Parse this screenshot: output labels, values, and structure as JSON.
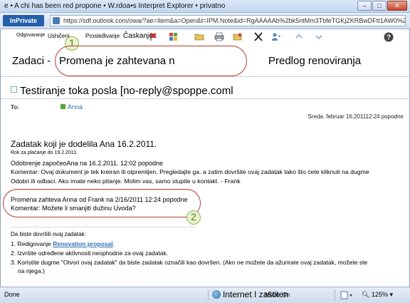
{
  "window": {
    "title": "e • A chi has been red propone • W.rdoa•s Interpret Explorer • privatno",
    "min": "–",
    "max": "□",
    "close": "✕"
  },
  "address": {
    "inprivate": "InPrivate",
    "url": "https://sdf.outlook.com/owa/?ae=Item&a=Open&t=IPM.Note&id=RgAAAAAb%2bk5ntMm3TbfeTGKjZKRBwDFtt1AW0%2fSAQIKF"
  },
  "toolbar": {
    "reply": "Odgovaranje",
    "reply_all": "Ushičeni",
    "forward": "Prosleđivanje",
    "chat": "Časkanje",
    "colors": {
      "categories_red": "#d14b3b",
      "categories_green": "#5aa845",
      "categories_blue": "#4b7dc2",
      "categories_yellow": "#e4b93a"
    }
  },
  "callouts": {
    "one": "1",
    "two": "2"
  },
  "header": {
    "tasks": "Zadaci -",
    "zoom_subject": "Promena je zahtevana n",
    "zoom_right": "Predlog renoviranja",
    "from": "Testiranje toka posla [no-reply@spoppe.coml",
    "to_label": "To:",
    "to_value": "Anna",
    "date": "Sreda. februar 16.201112:24 popodne"
  },
  "body": {
    "heading": "Zadatak koji je dodelila Ana 16.2.2011.",
    "due": "Rok za plaćanje do 19.2.2011.",
    "approved": "Odobrenje započeoAna na 16.2.2011. 12:02 popodne",
    "comment1": "Komentar: Ovaj dokument je tek kreiran ili otpremljen. Pregledajte ga. a zatim dovršite ovaj zadatak tako što ćete kliknuti na dugme",
    "comment2": "Odobri ili odbaci. Ako imate neko pitanje. Molim vas, samo stupite u kontakt. - Frank",
    "change_req": "Promena zahteva Anna od Frank na 2/16/2011 12:24 popodne",
    "change_comment": "Komentar: Možete li smanjiti dužinu Uvoda?",
    "steps_head": "Da biste dovršili ovaj zadatak:",
    "step1_prefix": "1. Redigovanje",
    "step1_link": "Renovation proposal",
    "step1_suffix": ".",
    "step2": "2. Izvršite određene aktivnosti neophodne za ovaj zadatak.",
    "step3a": "3. Koristite dugme \"Otvori ovaj zadatak\" da biste zadatak označili kao dovršen. (Ako ne možete da ažurirate ovaj zadatak, možete ste",
    "step3b": "na njega.)"
  },
  "status": {
    "left": "Done",
    "zone": "Internet I zaštiten",
    "mode": "Mode: On",
    "zoom": "125%"
  }
}
